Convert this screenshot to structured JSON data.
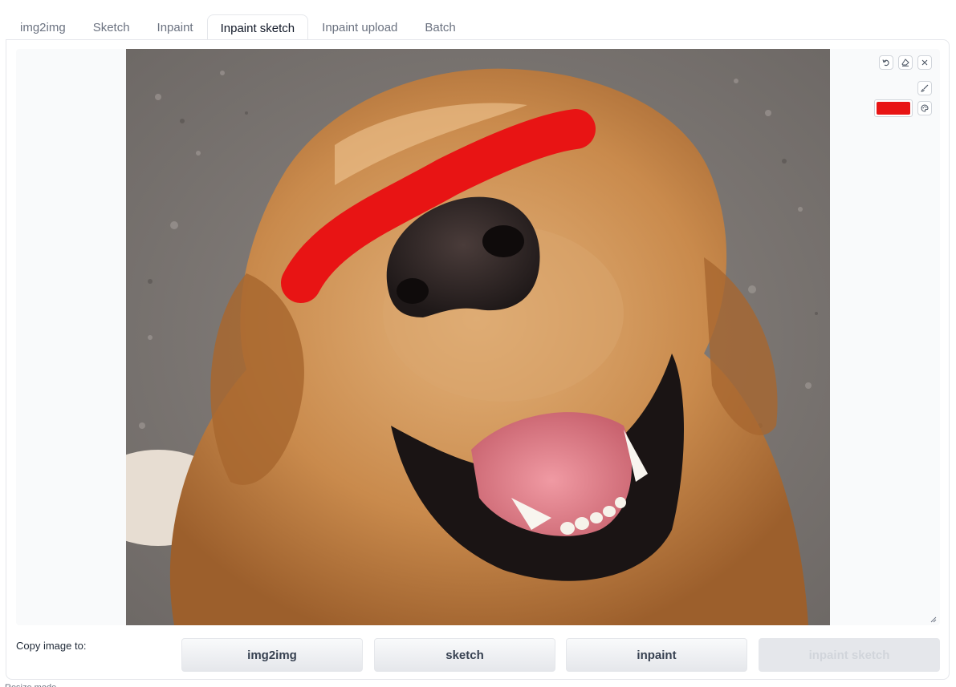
{
  "tabs": [
    {
      "label": "img2img",
      "active": false
    },
    {
      "label": "Sketch",
      "active": false
    },
    {
      "label": "Inpaint",
      "active": false
    },
    {
      "label": "Inpaint sketch",
      "active": true
    },
    {
      "label": "Inpaint upload",
      "active": false
    },
    {
      "label": "Batch",
      "active": false
    }
  ],
  "canvas": {
    "brush_color": "#e81414",
    "tools": [
      "undo-icon",
      "eraser-icon",
      "close-icon",
      "brush-icon",
      "palette-icon"
    ]
  },
  "copy": {
    "label": "Copy image to:",
    "buttons": [
      {
        "label": "img2img",
        "disabled": false
      },
      {
        "label": "sketch",
        "disabled": false
      },
      {
        "label": "inpaint",
        "disabled": false
      },
      {
        "label": "inpaint sketch",
        "disabled": true
      }
    ]
  },
  "footer": {
    "text": "Resize mode"
  }
}
